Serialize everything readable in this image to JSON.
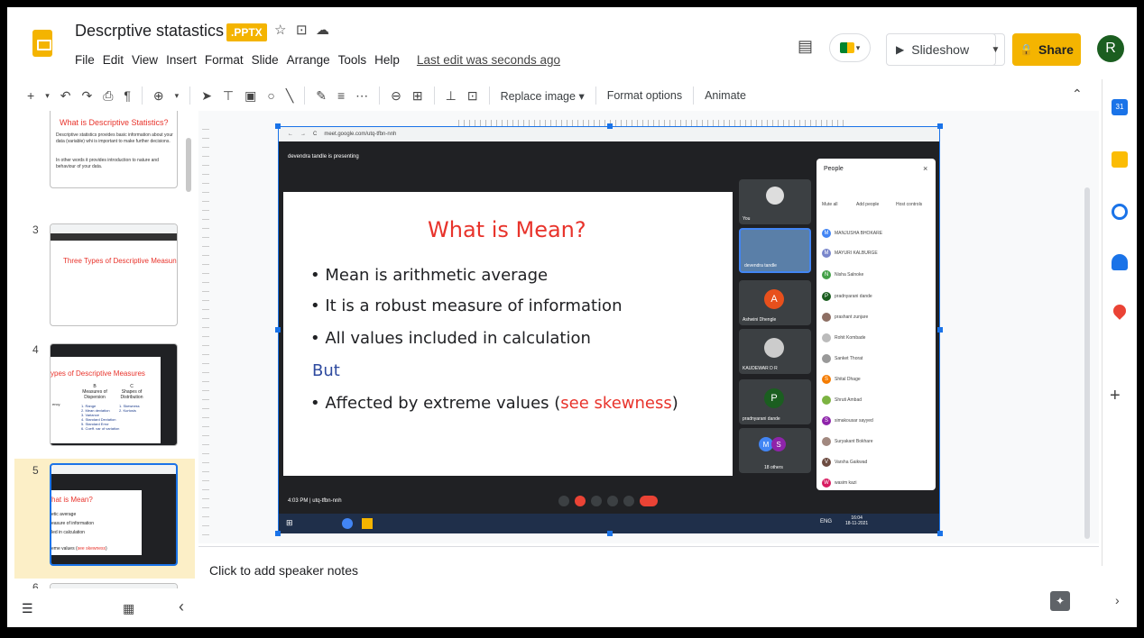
{
  "header": {
    "doc_title": "Descrptive statastics",
    "badge": ".PPTX",
    "menu": [
      "File",
      "Edit",
      "View",
      "Insert",
      "Format",
      "Slide",
      "Arrange",
      "Tools",
      "Help"
    ],
    "last_edit": "Last edit was seconds ago",
    "slideshow": "Slideshow",
    "share": "Share",
    "avatar": "R"
  },
  "toolbar": {
    "replace_image": "Replace image",
    "format_options": "Format options",
    "animate": "Animate"
  },
  "filmstrip": {
    "slide2_title": "What is Descriptive Statistics?",
    "slide2_b1": "Descriptive statistics provides basic information about your data (variable) whi is important to make further decisions.",
    "slide2_b2": "In other words it provides introduction to nature and behaviour of your data.",
    "num3": "3",
    "slide3_title": "Three Types of Descriptive Measun",
    "num4": "4",
    "slide4_title": "ypes of Descriptive Measures",
    "slide4_colb": "B",
    "slide4_colb_title": "Measures of Dispersion",
    "slide4_colc": "C",
    "slide4_colc_title": "Shapes of Distribution",
    "slide4_a_frag": "ency",
    "slide4_b_items": [
      "1. Range",
      "2. Mean deviation",
      "3. Variance",
      "4. Standard Deviation",
      "5. Standard Error",
      "6. Coeff. var of variation"
    ],
    "slide4_c_items": [
      "1. Skewness",
      "2. Kurtosis"
    ],
    "num5": "5",
    "slide5_title": "hat is Mean?",
    "slide5_l1": "etic average",
    "slide5_l2": "easure of information",
    "slide5_l3": "led in calculation",
    "slide5_l4a": "eme values (",
    "slide5_l4b": "see skewness",
    "slide5_l4c": ")",
    "num6": "6"
  },
  "slide": {
    "url": "meet.google.com/utq-tfbn-nnh",
    "presenting": "devendra tandle is presenting",
    "title": "What is Mean?",
    "bullet1": "• Mean is arithmetic average",
    "bullet2": "• It is a robust measure of information",
    "bullet3": "• All values included in calculation",
    "but": "But",
    "bullet4_pre": "• Affected by extreme values (",
    "bullet4_red": "see skewness",
    "bullet4_post": ")",
    "tiles": {
      "you": "You",
      "devendra": "devendra tandle",
      "ashwini_initial": "A",
      "ashwini": "Ashwini Dhengle",
      "kaudewar": "KAUDEWAR D R",
      "p_initial": "P",
      "pradnyarani": "pradnyarani dande",
      "others": "18 others",
      "m": "M",
      "s": "S"
    },
    "people_panel": {
      "title": "People",
      "close": "×",
      "mute_all": "Mute all",
      "add_people": "Add people",
      "host_controls": "Host controls",
      "names": [
        "MANJUSHA BHOKARE",
        "MAYURI KALBURGE",
        "Nisha Salnoke",
        "pradnyarani dande",
        "prashant zunjare",
        "Rohit Kombade",
        "Sanket Thorat",
        "Shital Dhage",
        "Shruti Ambad",
        "simakousar sayyed",
        "Suryakant Bokhare",
        "Varsha Gaikwad",
        "wasim kazi"
      ]
    },
    "meetbar_time": "4:03 PM | utq-tfbn-nnh",
    "taskbar_lang": "ENG",
    "taskbar_time": "16:04",
    "taskbar_date": "18-11-2021"
  },
  "notes": {
    "placeholder": "Click to add speaker notes"
  },
  "colors": {
    "accent": "#1a73e8",
    "share": "#f4b400",
    "red_text": "#e8332b",
    "but_blue": "#2e4a9f"
  }
}
